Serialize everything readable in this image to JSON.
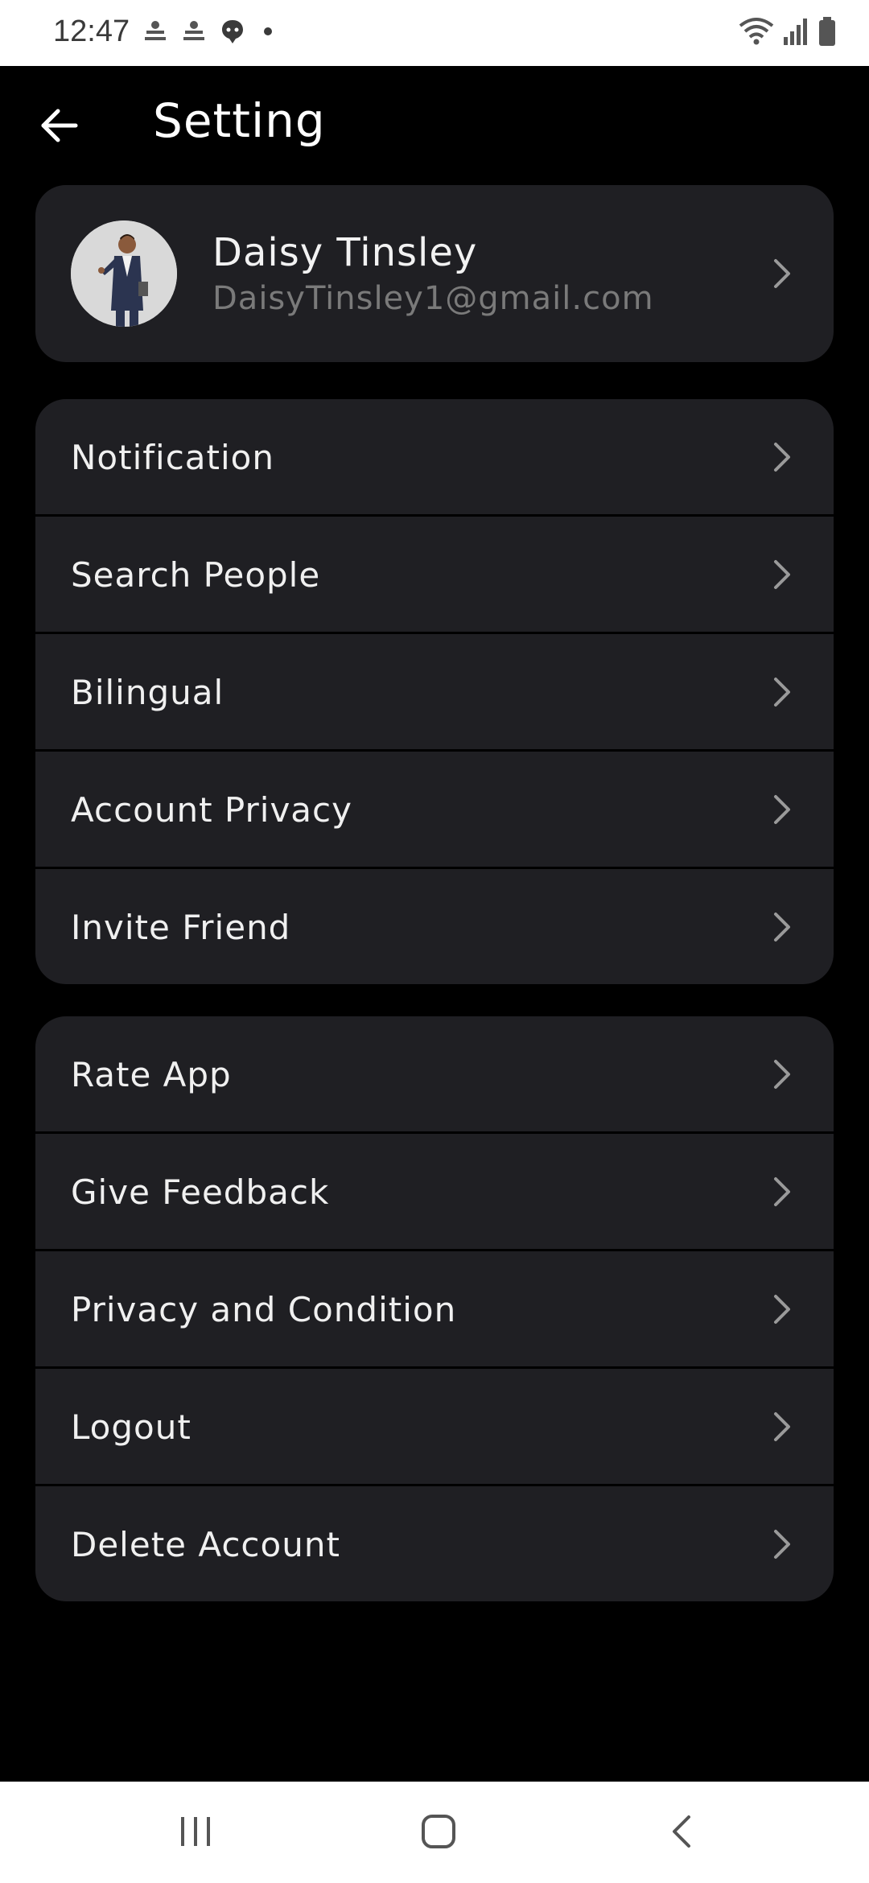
{
  "status_bar": {
    "time": "12:47"
  },
  "header": {
    "title": "Setting"
  },
  "profile": {
    "name": "Daisy Tinsley",
    "email": "DaisyTinsley1@gmail.com"
  },
  "menu_group_1": [
    {
      "label": "Notification"
    },
    {
      "label": "Search People"
    },
    {
      "label": "Bilingual"
    },
    {
      "label": "Account Privacy"
    },
    {
      "label": "Invite Friend"
    }
  ],
  "menu_group_2": [
    {
      "label": "Rate App"
    },
    {
      "label": "Give Feedback"
    },
    {
      "label": "Privacy and Condition"
    },
    {
      "label": "Logout"
    },
    {
      "label": "Delete Account"
    }
  ],
  "icons": {
    "back": "arrow-left-icon",
    "chevron": "chevron-right-icon",
    "nav_recents": "recents-icon",
    "nav_home": "home-icon",
    "nav_back": "back-icon"
  },
  "colors": {
    "background": "#000000",
    "card": "#1f1f23",
    "text_primary": "#f0f0f0",
    "text_secondary": "#7a7a7a"
  }
}
